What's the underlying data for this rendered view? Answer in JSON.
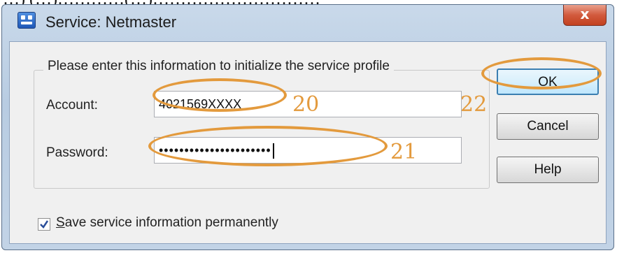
{
  "caption_fragment": "…) (…)…………(…)…………………………",
  "window": {
    "title": "Service: Netmaster",
    "close_glyph": "x"
  },
  "form": {
    "group_label": "Please enter this information to initialize the service profile",
    "account_label": "Account:",
    "account_value": "4021569XXXX",
    "password_label": "Password:",
    "password_value": "••••••••••••••••••••••"
  },
  "buttons": {
    "ok": "OK",
    "cancel": "Cancel",
    "help": "Help"
  },
  "save_option": {
    "checked": true,
    "label_prefix": "S",
    "label_rest": "ave service information permanently"
  },
  "annotations": {
    "account_marker": "20",
    "password_marker": "21",
    "ok_marker": "22",
    "color": "#e39a3d"
  },
  "icons": [
    "app-icon",
    "close-icon",
    "checkbox-check-icon"
  ]
}
